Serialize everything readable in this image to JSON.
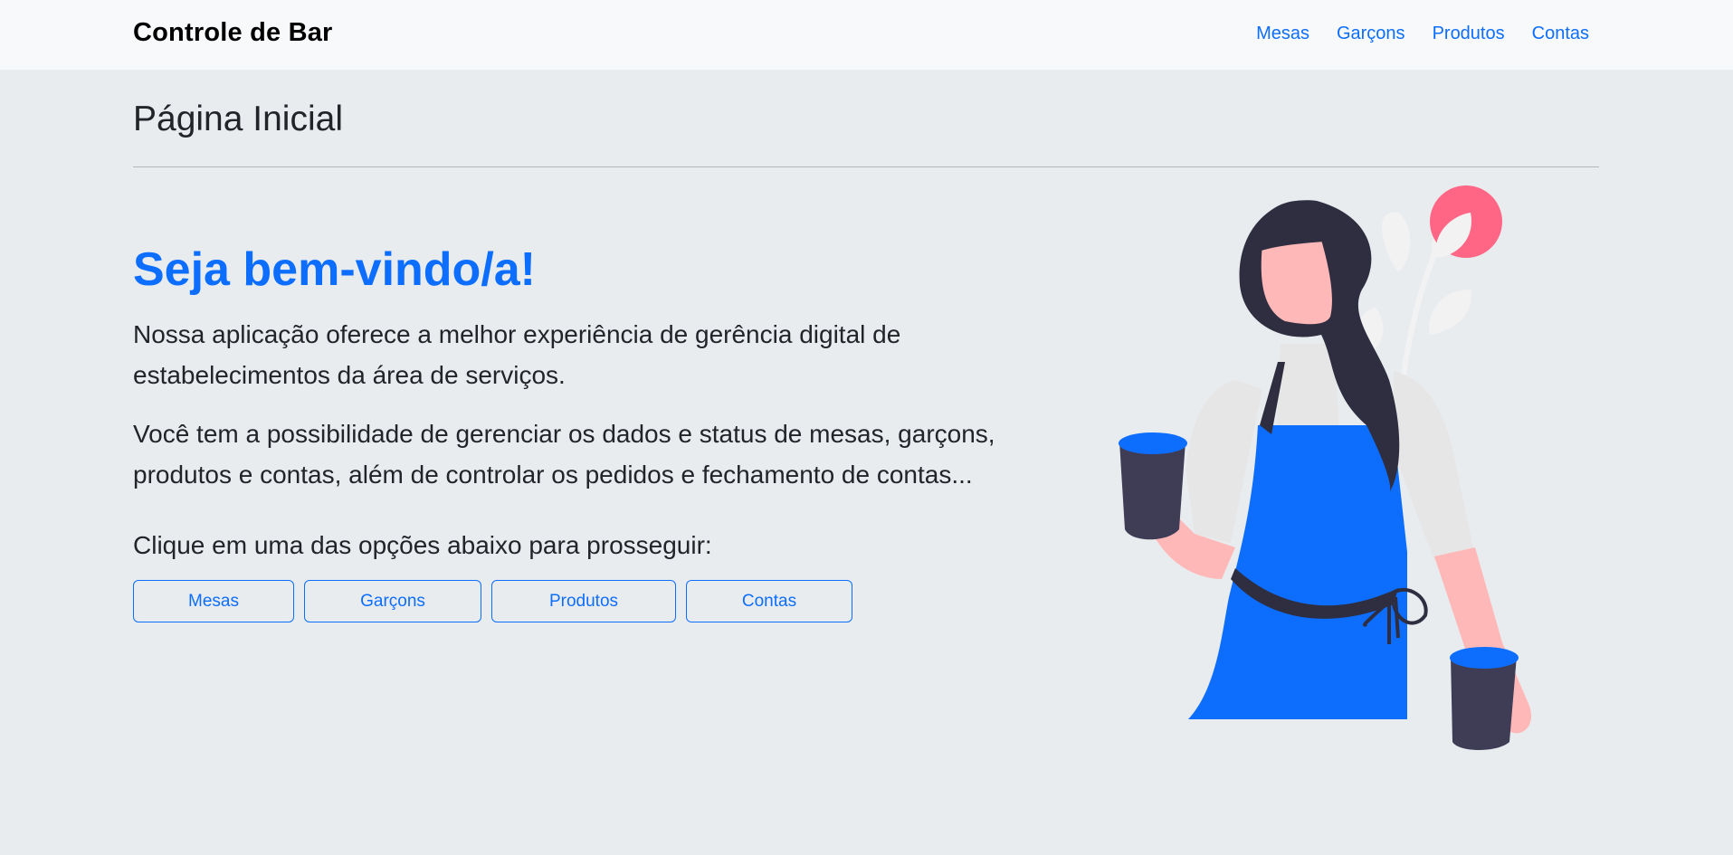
{
  "navbar": {
    "brand": "Controle de Bar",
    "links": [
      "Mesas",
      "Garçons",
      "Produtos",
      "Contas"
    ]
  },
  "page": {
    "title": "Página Inicial",
    "welcome": "Seja bem-vindo/a!",
    "paragraphs": [
      "Nossa aplicação oferece a melhor experiência de gerência digital de estabelecimentos da área de serviços.",
      "Você tem a possibilidade de gerenciar os dados e status de mesas, garçons, produtos e contas, além de controlar os pedidos e fechamento de contas...",
      "Clique em uma das opções abaixo para prosseguir:"
    ],
    "buttons": [
      "Mesas",
      "Garçons",
      "Produtos",
      "Contas"
    ]
  },
  "illustration": {
    "icon": "waitress-illustration",
    "colors": {
      "primary": "#0d6efd",
      "skin": "#ffb8b8",
      "hair": "#2f2e41",
      "cup": "#3f3d56",
      "accent": "#ff6584",
      "shirt": "#e6e6e6"
    }
  }
}
